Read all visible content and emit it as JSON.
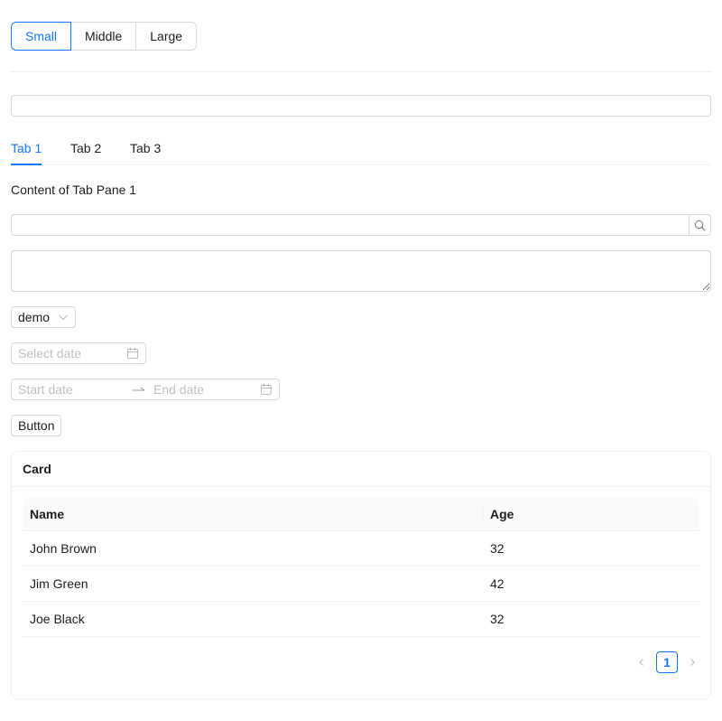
{
  "size_group": {
    "options": [
      "Small",
      "Middle",
      "Large"
    ],
    "selected": "Small"
  },
  "plain_input": {
    "value": "",
    "placeholder": ""
  },
  "tabs": {
    "items": [
      {
        "label": "Tab 1"
      },
      {
        "label": "Tab 2"
      },
      {
        "label": "Tab 3"
      }
    ],
    "active": "Tab 1",
    "content": "Content of Tab Pane 1"
  },
  "search": {
    "value": "",
    "placeholder": "",
    "icon": "search-icon"
  },
  "textarea": {
    "value": "",
    "placeholder": ""
  },
  "select": {
    "value": "demo",
    "icon": "chevron-down-icon"
  },
  "date_picker": {
    "placeholder": "Select date",
    "icon": "calendar-icon"
  },
  "range_picker": {
    "start_placeholder": "Start date",
    "end_placeholder": "End date",
    "separator_icon": "arrow-right-icon",
    "icon": "calendar-icon"
  },
  "button": {
    "label": "Button"
  },
  "card": {
    "title": "Card",
    "table": {
      "columns": [
        "Name",
        "Age"
      ],
      "rows": [
        {
          "name": "John Brown",
          "age": "32"
        },
        {
          "name": "Jim Green",
          "age": "42"
        },
        {
          "name": "Joe Black",
          "age": "32"
        }
      ]
    },
    "pagination": {
      "current": "1"
    }
  },
  "colors": {
    "primary": "#1677ff",
    "border": "#d9d9d9",
    "divider": "#f0f0f0",
    "header_bg": "#fafafa"
  }
}
